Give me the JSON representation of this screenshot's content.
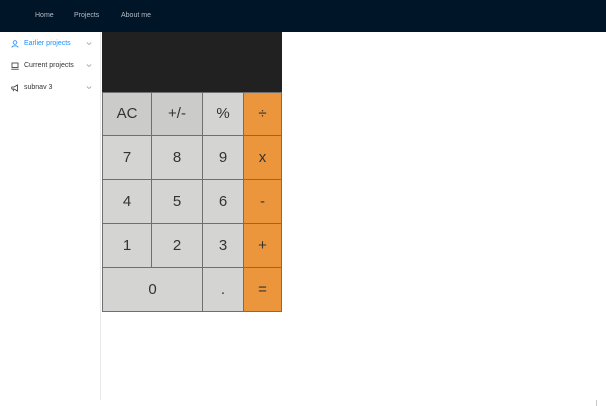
{
  "topnav": {
    "items": [
      {
        "label": "Home"
      },
      {
        "label": "Projects"
      },
      {
        "label": "About me"
      }
    ]
  },
  "sidebar": {
    "items": [
      {
        "label": "Earlier projects",
        "icon": "user-icon",
        "active": true
      },
      {
        "label": "Current projects",
        "icon": "laptop-icon",
        "active": false
      },
      {
        "label": "subnav 3",
        "icon": "notification-icon",
        "active": false
      }
    ]
  },
  "calculator": {
    "display": "",
    "keys": {
      "ac": "AC",
      "sign": "+/-",
      "percent": "%",
      "divide": "÷",
      "seven": "7",
      "eight": "8",
      "nine": "9",
      "multiply": "x",
      "four": "4",
      "five": "5",
      "six": "6",
      "minus": "-",
      "one": "1",
      "two": "2",
      "three": "3",
      "plus": "+",
      "zero": "0",
      "decimal": ".",
      "equals": "="
    }
  },
  "colors": {
    "header_bg": "#011529",
    "accent": "#1890ff",
    "operator": "#eb963c",
    "key": "#d4d4d2",
    "display_bg": "#212121"
  }
}
